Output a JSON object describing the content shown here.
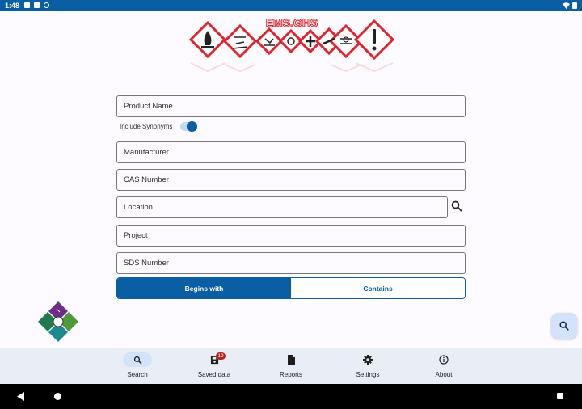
{
  "status_bar": {
    "time": "1:48"
  },
  "logo": {
    "text": "EMS.GHS"
  },
  "form": {
    "product_name": {
      "placeholder": "Product Name",
      "value": ""
    },
    "include_synonyms": {
      "label": "Include Synonyms",
      "on": true
    },
    "manufacturer": {
      "placeholder": "Manufacturer",
      "value": ""
    },
    "cas_number": {
      "placeholder": "CAS Number",
      "value": ""
    },
    "location": {
      "placeholder": "Location",
      "value": ""
    },
    "project": {
      "placeholder": "Project",
      "value": ""
    },
    "sds_number": {
      "placeholder": "SDS Number",
      "value": ""
    },
    "match_mode": {
      "options": [
        "Begins with",
        "Contains"
      ],
      "selected": "Begins with"
    }
  },
  "bottom_nav": {
    "items": [
      {
        "label": "Search",
        "icon": "search-icon",
        "active": true
      },
      {
        "label": "Saved data",
        "icon": "save-icon",
        "badge": "19"
      },
      {
        "label": "Reports",
        "icon": "document-icon"
      },
      {
        "label": "Settings",
        "icon": "gear-icon"
      },
      {
        "label": "About",
        "icon": "info-icon"
      }
    ]
  },
  "colors": {
    "primary": "#0a5ea4",
    "nav_bg": "#e9eef6",
    "active_pill": "#d3e3fd",
    "badge": "#b3261e",
    "ghs_red": "#e5212b"
  }
}
